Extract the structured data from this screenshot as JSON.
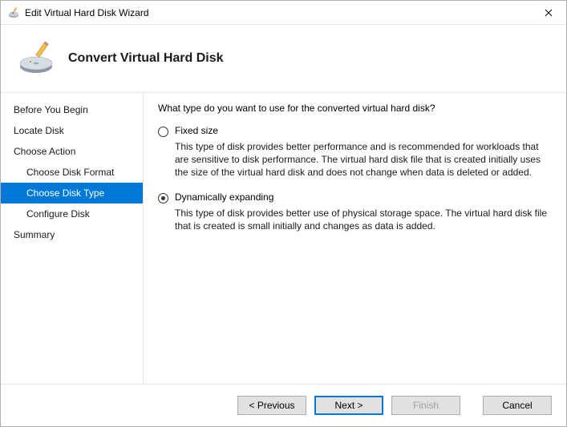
{
  "window": {
    "title": "Edit Virtual Hard Disk Wizard"
  },
  "header": {
    "title": "Convert Virtual Hard Disk"
  },
  "sidebar": {
    "items": [
      {
        "label": "Before You Begin",
        "indent": 0,
        "selected": false
      },
      {
        "label": "Locate Disk",
        "indent": 0,
        "selected": false
      },
      {
        "label": "Choose Action",
        "indent": 0,
        "selected": false
      },
      {
        "label": "Choose Disk Format",
        "indent": 1,
        "selected": false
      },
      {
        "label": "Choose Disk Type",
        "indent": 1,
        "selected": true
      },
      {
        "label": "Configure Disk",
        "indent": 1,
        "selected": false
      },
      {
        "label": "Summary",
        "indent": 0,
        "selected": false
      }
    ]
  },
  "main": {
    "prompt": "What type do you want to use for the converted virtual hard disk?",
    "options": [
      {
        "label": "Fixed size",
        "checked": false,
        "desc": "This type of disk provides better performance and is recommended for workloads that are sensitive to disk performance. The virtual hard disk file that is created initially uses the size of the virtual hard disk and does not change when data is deleted or added."
      },
      {
        "label": "Dynamically expanding",
        "checked": true,
        "desc": "This type of disk provides better use of physical storage space. The virtual hard disk file that is created is small initially and changes as data is added."
      }
    ]
  },
  "footer": {
    "previous": "< Previous",
    "next": "Next >",
    "finish": "Finish",
    "cancel": "Cancel"
  }
}
